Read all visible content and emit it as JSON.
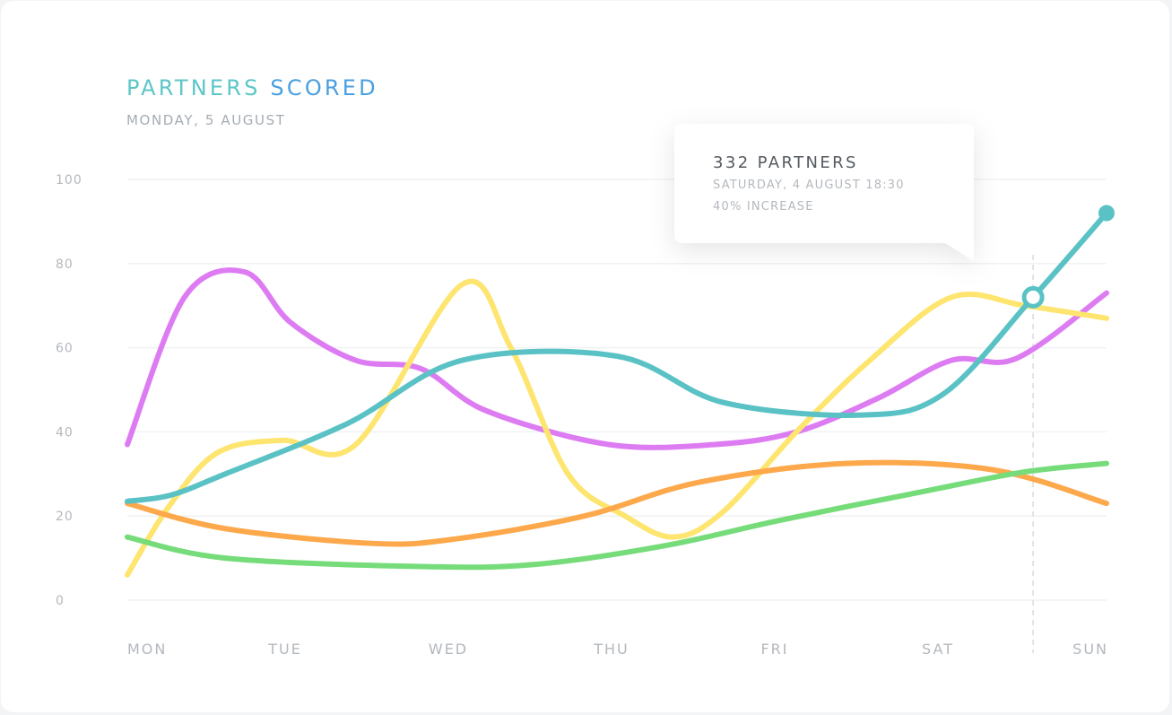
{
  "header": {
    "title_part1": "PARTNERS",
    "title_part2": "SCORED",
    "subtitle": "MONDAY, 5 AUGUST"
  },
  "tooltip": {
    "headline": "332 PARTNERS",
    "datetime": "SATURDAY, 4 AUGUST 18:30",
    "change": "40% INCREASE"
  },
  "colors": {
    "teal": "#5ac2c5",
    "purple": "#dd7cf2",
    "yellow": "#fde56f",
    "orange": "#fca84b",
    "green": "#76dc7a"
  },
  "chart_data": {
    "type": "line",
    "title": "PARTNERS SCORED",
    "subtitle": "MONDAY, 5 AUGUST",
    "categories": [
      "MON",
      "TUE",
      "WED",
      "THU",
      "FRI",
      "SAT",
      "SUN"
    ],
    "ylim": [
      0,
      100
    ],
    "yticks": [
      0,
      20,
      40,
      60,
      80,
      100
    ],
    "grid": true,
    "smooth": true,
    "series": [
      {
        "color": "teal",
        "x": [
          0,
          0.27,
          0.6,
          1.35,
          2.05,
          3.0,
          3.65,
          4.5,
          5.0,
          5.55,
          6.0
        ],
        "values": [
          23.5,
          25,
          30,
          42,
          57,
          58,
          47,
          44,
          49,
          72,
          92
        ]
      },
      {
        "color": "purple",
        "x": [
          0,
          0.35,
          0.72,
          1.0,
          1.4,
          1.8,
          2.2,
          2.95,
          3.6,
          4.1,
          4.6,
          5.05,
          5.45,
          6.0
        ],
        "values": [
          37,
          72,
          78,
          66,
          57,
          55,
          45,
          37,
          37,
          40,
          48,
          57,
          57.5,
          73
        ]
      },
      {
        "color": "yellow",
        "x": [
          0,
          0.25,
          0.55,
          0.95,
          1.4,
          2.05,
          2.35,
          2.7,
          3.05,
          3.35,
          3.65,
          4.1,
          4.55,
          5.05,
          5.5,
          6.0
        ],
        "values": [
          6,
          22,
          35,
          38,
          37,
          75,
          60,
          30,
          20,
          15,
          21,
          40,
          57,
          72,
          70,
          67
        ]
      },
      {
        "color": "orange",
        "x": [
          0,
          0.6,
          1.5,
          2.0,
          2.8,
          3.5,
          4.4,
          5.3,
          6.0
        ],
        "values": [
          23,
          17,
          13.5,
          14.5,
          20,
          28,
          32.5,
          31,
          23
        ]
      },
      {
        "color": "green",
        "x": [
          0,
          0.6,
          1.8,
          2.5,
          3.3,
          4.0,
          4.9,
          5.5,
          6.0
        ],
        "values": [
          15,
          10,
          8,
          8.5,
          13,
          19,
          26,
          30.5,
          32.5
        ]
      }
    ],
    "highlight": {
      "series": "teal",
      "x": 5.55,
      "value": 72
    },
    "end_marker": {
      "series": "teal",
      "x": 6.0,
      "value": 92
    }
  }
}
